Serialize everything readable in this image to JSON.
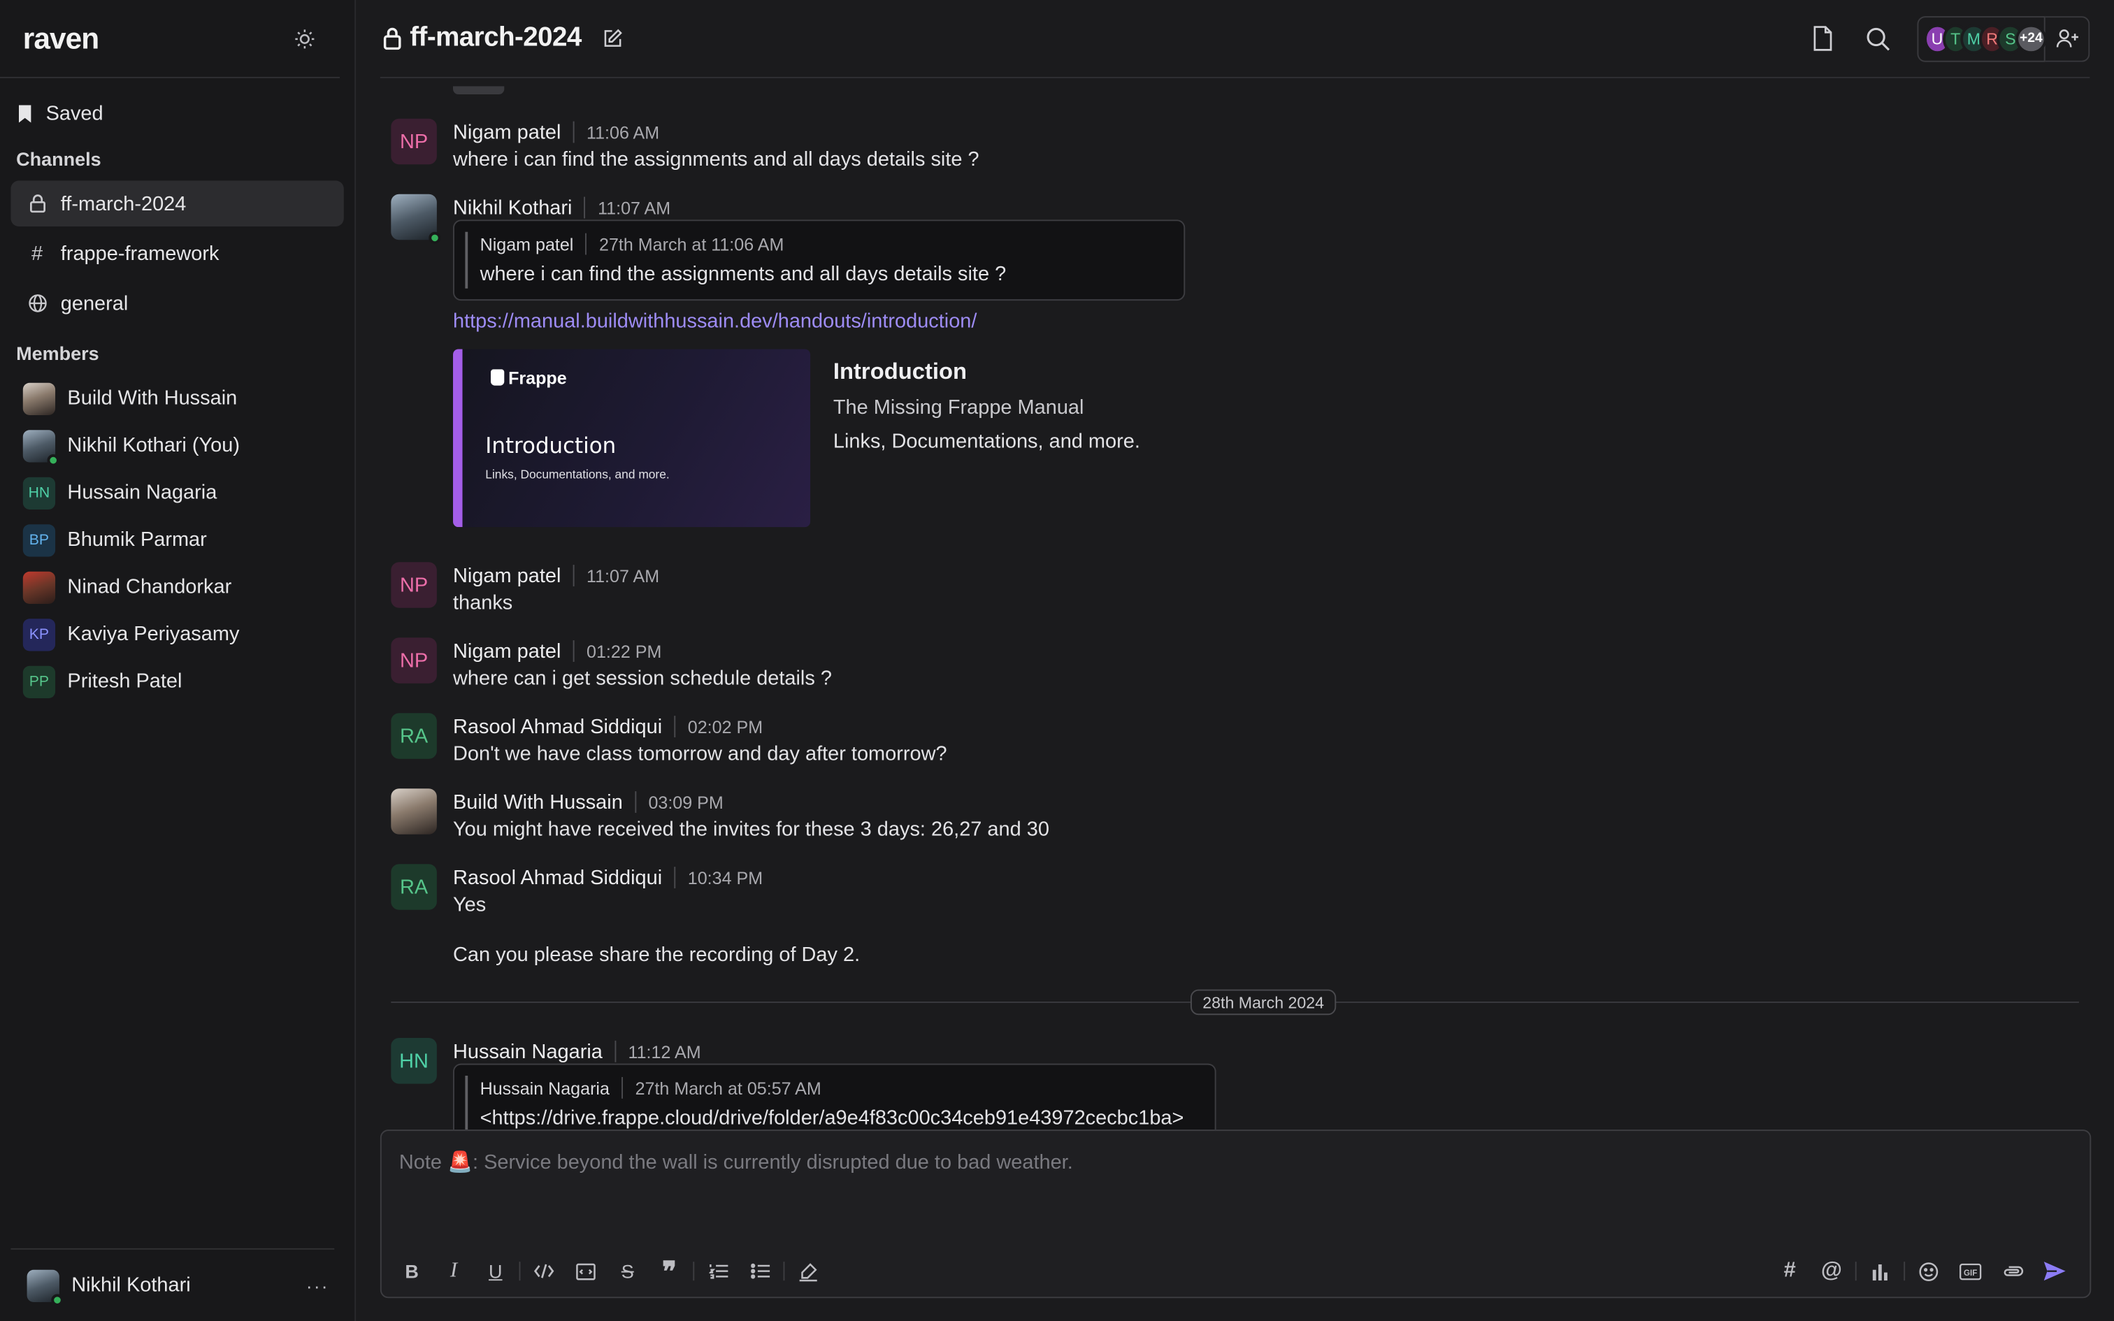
{
  "app": {
    "logo": "raven"
  },
  "sidebar": {
    "saved_label": "Saved",
    "channels_title": "Channels",
    "channels": [
      {
        "label": "ff-march-2024",
        "icon": "lock-icon",
        "active": true
      },
      {
        "label": "frappe-framework",
        "icon": "hash-icon",
        "active": false
      },
      {
        "label": "general",
        "icon": "globe-icon",
        "active": false
      }
    ],
    "members_title": "Members",
    "members": [
      {
        "label": "Build With Hussain",
        "initials": ""
      },
      {
        "label": "Nikhil Kothari (You)",
        "initials": ""
      },
      {
        "label": "Hussain Nagaria",
        "initials": "HN"
      },
      {
        "label": "Bhumik Parmar",
        "initials": "BP"
      },
      {
        "label": "Ninad Chandorkar",
        "initials": ""
      },
      {
        "label": "Kaviya Periyasamy",
        "initials": "KP"
      },
      {
        "label": "Pritesh Patel",
        "initials": "PP"
      }
    ],
    "current_user": "Nikhil Kothari",
    "more_label": "···"
  },
  "header": {
    "channel_name": "ff-march-2024",
    "member_avatars": [
      "U",
      "T",
      "M",
      "R",
      "S"
    ],
    "member_extra": "+24"
  },
  "messages": {
    "m1": {
      "initials": "NP",
      "name": "Nigam patel",
      "time": "11:06 AM",
      "text": "where i can find the assignments and all days details site ?"
    },
    "m2": {
      "name": "Nikhil Kothari",
      "time": "11:07 AM",
      "quote": {
        "name": "Nigam patel",
        "time": "27th March at 11:06 AM",
        "text": "where i can find the assignments and all days details site ?"
      },
      "link": "https://manual.buildwithhussain.dev/handouts/introduction/",
      "preview": {
        "brand": "Frappe",
        "image_title": "Introduction",
        "image_sub": "Links, Documentations, and more.",
        "title": "Introduction",
        "desc": "The Missing Frappe Manual",
        "body": "Links, Documentations, and more."
      }
    },
    "m3": {
      "initials": "NP",
      "name": "Nigam patel",
      "time": "11:07 AM",
      "text": "thanks"
    },
    "m4": {
      "initials": "NP",
      "name": "Nigam patel",
      "time": "01:22 PM",
      "text": "where can i get session schedule details ?"
    },
    "m5": {
      "initials": "RA",
      "name": "Rasool Ahmad Siddiqui",
      "time": "02:02 PM",
      "text": "Don't we have class tomorrow and day after tomorrow?"
    },
    "m6": {
      "name": "Build With Hussain",
      "time": "03:09 PM",
      "text": "You might have received the invites for these 3 days: 26,27 and 30"
    },
    "m7": {
      "initials": "RA",
      "name": "Rasool Ahmad Siddiqui",
      "time": "10:34 PM",
      "text": "Yes",
      "text2": "Can you please share the recording of Day 2."
    },
    "date_divider": "28th March 2024",
    "m8": {
      "initials": "HN",
      "name": "Hussain Nagaria",
      "time": "11:12 AM",
      "quote": {
        "name": "Hussain Nagaria",
        "time": "27th March at 05:57 AM",
        "text": "<https://drive.frappe.cloud/drive/folder/a9e4f83c00c34ceb91e43972cecbc1ba>"
      }
    }
  },
  "composer": {
    "placeholder": "Note 🚨: Service beyond the wall is currently disrupted due to bad weather."
  },
  "colors": {
    "accent": "#8c7cf5",
    "link": "#9e8cf5",
    "online": "#35b05a",
    "background": "#1b1b1d"
  }
}
